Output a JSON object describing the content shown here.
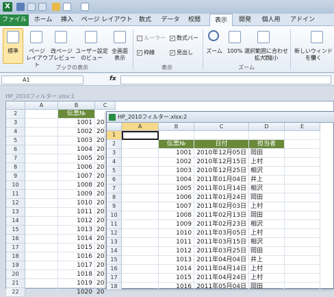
{
  "ribbon_tabs": [
    "ファイル",
    "ホーム",
    "挿入",
    "ページ レイアウト",
    "数式",
    "データ",
    "校閲",
    "表示",
    "開発",
    "個人用",
    "アドイン"
  ],
  "ribbon": {
    "standard": "標準",
    "page_layout": [
      "ページ",
      "レイアウト"
    ],
    "page_break": [
      "改ページ",
      "プレビュー"
    ],
    "user_view": [
      "ユーザー設定",
      "のビュー"
    ],
    "full_screen": [
      "全画面",
      "表示"
    ],
    "group_book_views": "ブックの表示",
    "ruler": "ルーラー",
    "formula_bar": "数式バー",
    "gridlines": "枠線",
    "headings": "見出し",
    "group_show": "表示",
    "zoom": "ズーム",
    "zoom100": "100%",
    "zoom_sel": [
      "選択範囲に合わせて",
      "拡大/縮小"
    ],
    "group_zoom": "ズーム",
    "new_window": [
      "新しいウィンドウ",
      "を開く"
    ]
  },
  "formula_bar": {
    "name_box": "A1",
    "fx": "fx",
    "value": ""
  },
  "window1": {
    "title": "HP_2010フィルター.xlsx:1",
    "columns": [
      "A",
      "B",
      "C"
    ],
    "header_b": "伝票№",
    "rows": [
      {
        "r": "2",
        "b": ""
      },
      {
        "r": "3",
        "b": "1001"
      },
      {
        "r": "4",
        "b": "1002"
      },
      {
        "r": "5",
        "b": "1003"
      },
      {
        "r": "6",
        "b": "1004"
      },
      {
        "r": "7",
        "b": "1005"
      },
      {
        "r": "8",
        "b": "1006"
      },
      {
        "r": "9",
        "b": "1007"
      },
      {
        "r": "10",
        "b": "1008"
      },
      {
        "r": "11",
        "b": "1009"
      },
      {
        "r": "12",
        "b": "1010"
      },
      {
        "r": "13",
        "b": "1011"
      },
      {
        "r": "14",
        "b": "1012"
      },
      {
        "r": "15",
        "b": "1013"
      },
      {
        "r": "16",
        "b": "1014"
      },
      {
        "r": "17",
        "b": "1015"
      },
      {
        "r": "18",
        "b": "1016"
      },
      {
        "r": "19",
        "b": "1017"
      },
      {
        "r": "20",
        "b": "1018"
      },
      {
        "r": "21",
        "b": "1019"
      },
      {
        "r": "22",
        "b": "1020"
      }
    ],
    "c_prefix": "20"
  },
  "window2": {
    "title": "HP_2010フィルター.xlsx:2",
    "columns": [
      "A",
      "B",
      "C",
      "D",
      "E"
    ],
    "headers": [
      "伝票№",
      "日付",
      "担当者"
    ],
    "rows": [
      [
        "1001",
        "2010年12月05日",
        "岡田"
      ],
      [
        "1002",
        "2010年12月15日",
        "上村"
      ],
      [
        "1003",
        "2010年12月25日",
        "相沢"
      ],
      [
        "1004",
        "2011年01月04日",
        "井上"
      ],
      [
        "1005",
        "2011年01月14日",
        "相沢"
      ],
      [
        "1006",
        "2011年01月24日",
        "岡田"
      ],
      [
        "1007",
        "2011年02月03日",
        "上村"
      ],
      [
        "1008",
        "2011年02月13日",
        "岡田"
      ],
      [
        "1009",
        "2011年02月23日",
        "相沢"
      ],
      [
        "1010",
        "2011年03月05日",
        "上村"
      ],
      [
        "1011",
        "2011年03月15日",
        "相沢"
      ],
      [
        "1012",
        "2011年03月25日",
        "岡田"
      ],
      [
        "1013",
        "2011年04月04日",
        "井上"
      ],
      [
        "1014",
        "2011年04月14日",
        "上村"
      ],
      [
        "1015",
        "2011年04月24日",
        "上村"
      ],
      [
        "1016",
        "2011年05月04日",
        "岡田"
      ]
    ]
  }
}
